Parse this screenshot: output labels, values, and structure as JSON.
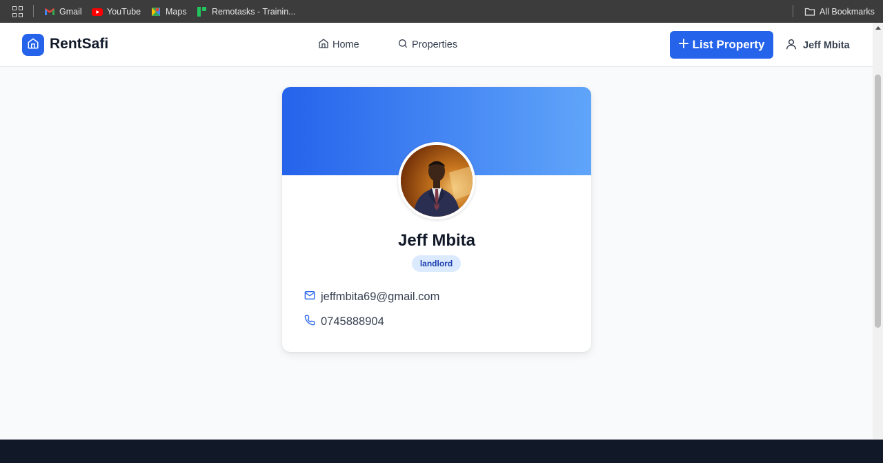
{
  "bookmarks_bar": {
    "items": [
      {
        "label": "Gmail",
        "icon": "gmail-icon"
      },
      {
        "label": "YouTube",
        "icon": "youtube-icon"
      },
      {
        "label": "Maps",
        "icon": "maps-icon"
      },
      {
        "label": "Remotasks - Trainin...",
        "icon": "remotasks-icon"
      }
    ],
    "all_bookmarks": "All Bookmarks"
  },
  "header": {
    "brand": "RentSafi",
    "nav": [
      {
        "label": "Home",
        "icon": "home-icon"
      },
      {
        "label": "Properties",
        "icon": "search-icon"
      }
    ],
    "list_button": "List Property",
    "user_name": "Jeff Mbita"
  },
  "profile": {
    "name": "Jeff Mbita",
    "role": "landlord",
    "email": "jeffmbita69@gmail.com",
    "phone": "0745888904"
  },
  "colors": {
    "primary": "#2563eb",
    "banner_start": "#2563eb",
    "banner_end": "#60a5fa",
    "badge_bg": "#dbeafe",
    "badge_text": "#1e40af",
    "footer": "#111827"
  }
}
